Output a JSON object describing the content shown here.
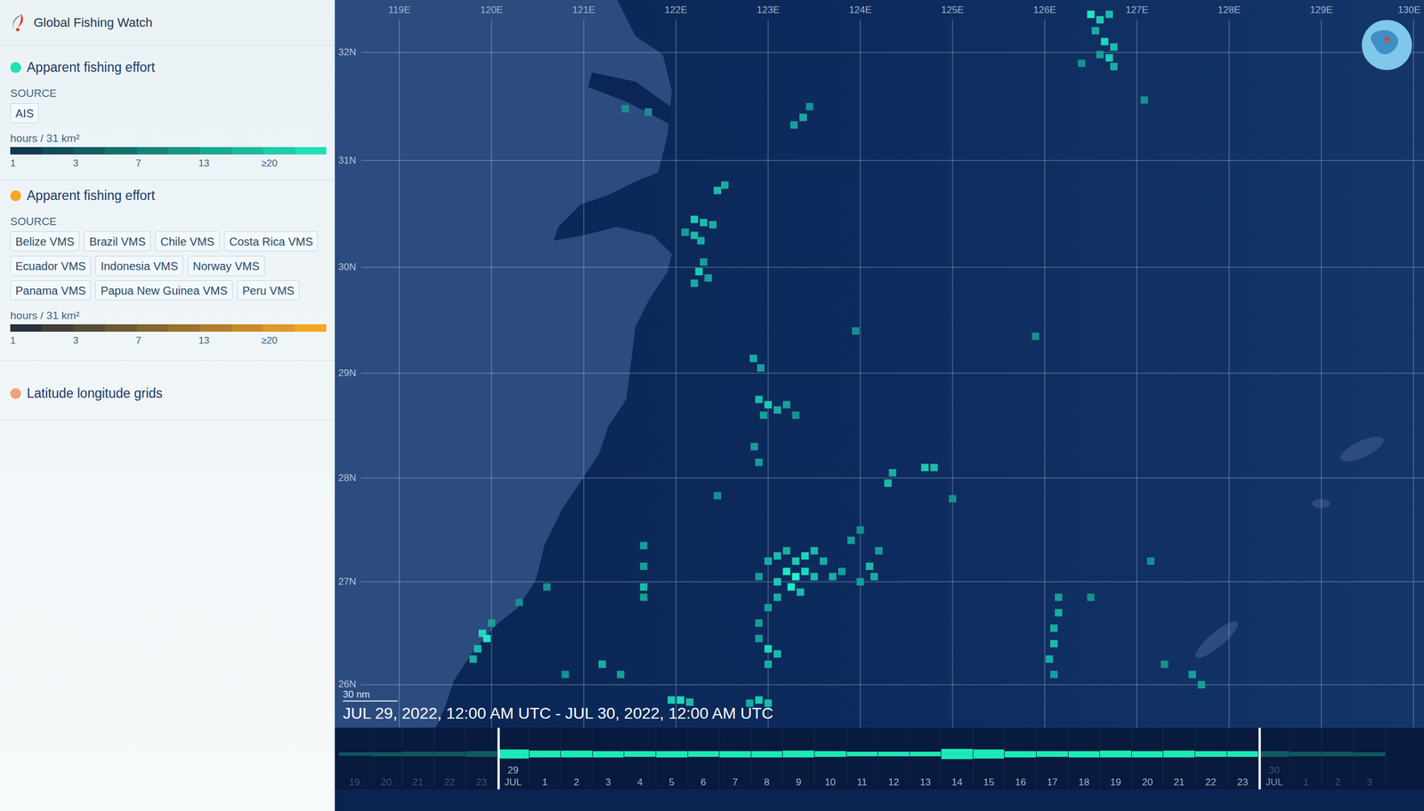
{
  "sidebar": {
    "app_title": "Global Fishing Watch",
    "layers": [
      {
        "title": "Apparent fishing effort",
        "color": "#1fe0b4",
        "source_label": "SOURCE",
        "sources": [
          "AIS"
        ],
        "unit": "hours / 31 km²",
        "ticks": [
          "1",
          "3",
          "7",
          "13",
          "≥20"
        ]
      },
      {
        "title": "Apparent fishing effort",
        "color": "#f6a623",
        "source_label": "SOURCE",
        "sources": [
          "Belize VMS",
          "Brazil VMS",
          "Chile VMS",
          "Costa Rica VMS",
          "Ecuador VMS",
          "Indonesia VMS",
          "Norway VMS",
          "Panama VMS",
          "Papua New Guinea VMS",
          "Peru VMS"
        ],
        "unit": "hours / 31 km²",
        "ticks": [
          "1",
          "3",
          "7",
          "13",
          "≥20"
        ]
      }
    ],
    "grid_layer": {
      "title": "Latitude longitude grids",
      "color": "#f0a07c"
    }
  },
  "map": {
    "longitudes": [
      {
        "value": 119,
        "label": "119E"
      },
      {
        "value": 120,
        "label": "120E"
      },
      {
        "value": 121,
        "label": "121E"
      },
      {
        "value": 122,
        "label": "122E"
      },
      {
        "value": 123,
        "label": "123E"
      },
      {
        "value": 124,
        "label": "124E"
      },
      {
        "value": 125,
        "label": "125E"
      },
      {
        "value": 126,
        "label": "126E"
      },
      {
        "value": 127,
        "label": "127E"
      },
      {
        "value": 128,
        "label": "128E"
      },
      {
        "value": 129,
        "label": "129E"
      },
      {
        "value": 130,
        "label": "130E"
      }
    ],
    "latitudes": [
      {
        "value": 32,
        "label": "32N"
      },
      {
        "value": 31,
        "label": "31N"
      },
      {
        "value": 30,
        "label": "30N"
      },
      {
        "value": 29,
        "label": "29N"
      },
      {
        "value": 28,
        "label": "28N"
      },
      {
        "value": 27,
        "label": "27N"
      },
      {
        "value": 26,
        "label": "26N"
      }
    ],
    "scale_label": "30 nm",
    "date_range": "JUL 29, 2022, 12:00 AM UTC - JUL 30, 2022, 12:00 AM UTC",
    "effort_cells": [
      [
        126.5,
        32.35,
        0.9
      ],
      [
        126.6,
        32.3,
        0.7
      ],
      [
        126.7,
        32.35,
        0.6
      ],
      [
        126.55,
        32.2,
        0.5
      ],
      [
        126.65,
        32.1,
        0.8
      ],
      [
        126.75,
        32.05,
        0.6
      ],
      [
        126.7,
        31.95,
        0.7
      ],
      [
        126.75,
        31.87,
        0.5
      ],
      [
        126.4,
        31.9,
        0.3
      ],
      [
        126.6,
        31.98,
        0.4
      ],
      [
        127.08,
        31.56,
        0.3
      ],
      [
        123.38,
        31.4,
        0.5
      ],
      [
        123.28,
        31.33,
        0.4
      ],
      [
        123.45,
        31.5,
        0.3
      ],
      [
        121.45,
        31.48,
        0.3
      ],
      [
        121.7,
        31.45,
        0.3
      ],
      [
        122.45,
        30.72,
        0.6
      ],
      [
        122.53,
        30.77,
        0.5
      ],
      [
        122.2,
        30.45,
        0.7
      ],
      [
        122.3,
        30.42,
        0.6
      ],
      [
        122.4,
        30.4,
        0.5
      ],
      [
        122.2,
        30.3,
        0.6
      ],
      [
        122.27,
        30.25,
        0.5
      ],
      [
        122.1,
        30.33,
        0.4
      ],
      [
        122.25,
        29.96,
        0.7
      ],
      [
        122.35,
        29.9,
        0.4
      ],
      [
        122.2,
        29.85,
        0.5
      ],
      [
        122.3,
        30.05,
        0.4
      ],
      [
        122.84,
        29.14,
        0.5
      ],
      [
        122.92,
        29.05,
        0.4
      ],
      [
        122.9,
        28.75,
        0.6
      ],
      [
        123.0,
        28.7,
        0.7
      ],
      [
        123.1,
        28.65,
        0.5
      ],
      [
        123.2,
        28.7,
        0.4
      ],
      [
        122.95,
        28.6,
        0.4
      ],
      [
        123.3,
        28.6,
        0.3
      ],
      [
        122.85,
        28.3,
        0.4
      ],
      [
        122.9,
        28.15,
        0.4
      ],
      [
        122.45,
        27.83,
        0.3
      ],
      [
        124.3,
        27.95,
        0.6
      ],
      [
        124.35,
        28.05,
        0.5
      ],
      [
        124.7,
        28.1,
        0.7
      ],
      [
        124.8,
        28.1,
        0.6
      ],
      [
        125.0,
        27.8,
        0.3
      ],
      [
        123.0,
        27.2,
        0.5
      ],
      [
        123.1,
        27.25,
        0.6
      ],
      [
        123.2,
        27.3,
        0.5
      ],
      [
        123.3,
        27.2,
        0.7
      ],
      [
        123.4,
        27.25,
        0.8
      ],
      [
        123.5,
        27.3,
        0.6
      ],
      [
        123.6,
        27.2,
        0.5
      ],
      [
        123.2,
        27.1,
        0.9
      ],
      [
        123.3,
        27.05,
        1
      ],
      [
        123.4,
        27.1,
        0.8
      ],
      [
        123.5,
        27.05,
        0.6
      ],
      [
        123.1,
        27.0,
        0.7
      ],
      [
        123.25,
        26.95,
        0.9
      ],
      [
        123.35,
        26.9,
        0.6
      ],
      [
        122.9,
        27.05,
        0.4
      ],
      [
        123.7,
        27.05,
        0.5
      ],
      [
        123.8,
        27.1,
        0.4
      ],
      [
        123.1,
        26.85,
        0.5
      ],
      [
        123.0,
        26.75,
        0.4
      ],
      [
        124.1,
        27.15,
        0.6
      ],
      [
        124.15,
        27.05,
        0.5
      ],
      [
        124.0,
        27.0,
        0.4
      ],
      [
        124.2,
        27.3,
        0.4
      ],
      [
        123.9,
        27.4,
        0.4
      ],
      [
        124.0,
        27.5,
        0.3
      ],
      [
        121.65,
        27.35,
        0.4
      ],
      [
        121.65,
        27.15,
        0.4
      ],
      [
        121.65,
        26.95,
        0.6
      ],
      [
        121.65,
        26.85,
        0.4
      ],
      [
        122.9,
        26.45,
        0.4
      ],
      [
        123.0,
        26.35,
        0.8
      ],
      [
        123.1,
        26.3,
        0.6
      ],
      [
        123.0,
        26.2,
        0.5
      ],
      [
        122.9,
        26.6,
        0.4
      ],
      [
        119.9,
        26.5,
        0.8
      ],
      [
        119.95,
        26.45,
        0.9
      ],
      [
        119.85,
        26.35,
        0.6
      ],
      [
        119.8,
        26.25,
        0.5
      ],
      [
        120.0,
        26.6,
        0.4
      ],
      [
        120.3,
        26.8,
        0.3
      ],
      [
        120.6,
        26.95,
        0.3
      ],
      [
        121.95,
        25.85,
        0.7
      ],
      [
        122.05,
        25.85,
        0.8
      ],
      [
        122.15,
        25.83,
        0.6
      ],
      [
        122.9,
        25.85,
        0.7
      ],
      [
        123.0,
        25.82,
        0.6
      ],
      [
        122.8,
        25.82,
        0.5
      ],
      [
        121.2,
        26.2,
        0.5
      ],
      [
        121.4,
        26.1,
        0.4
      ],
      [
        120.8,
        26.1,
        0.3
      ],
      [
        126.15,
        26.85,
        0.4
      ],
      [
        126.15,
        26.7,
        0.5
      ],
      [
        126.1,
        26.55,
        0.5
      ],
      [
        126.1,
        26.4,
        0.6
      ],
      [
        126.05,
        26.25,
        0.5
      ],
      [
        126.1,
        26.1,
        0.4
      ],
      [
        126.5,
        26.85,
        0.3
      ],
      [
        127.3,
        26.2,
        0.3
      ],
      [
        127.6,
        26.1,
        0.4
      ],
      [
        127.7,
        26.0,
        0.4
      ],
      [
        127.15,
        27.2,
        0.3
      ],
      [
        125.9,
        29.35,
        0.3
      ],
      [
        123.95,
        29.4,
        0.3
      ]
    ]
  },
  "timeline": {
    "ticks": [
      {
        "label": "19",
        "in_range": false,
        "handle": false,
        "activity": 0.2
      },
      {
        "label": "20",
        "in_range": false,
        "handle": false,
        "activity": 0.25
      },
      {
        "label": "21",
        "in_range": false,
        "handle": false,
        "activity": 0.3
      },
      {
        "label": "22",
        "in_range": false,
        "handle": false,
        "activity": 0.35
      },
      {
        "label": "23",
        "in_range": false,
        "handle": false,
        "activity": 0.4
      },
      {
        "label": "29",
        "sublabel": "JUL",
        "in_range": true,
        "handle": true,
        "activity": 0.8
      },
      {
        "label": "1",
        "in_range": true,
        "handle": false,
        "activity": 0.6
      },
      {
        "label": "2",
        "in_range": true,
        "handle": false,
        "activity": 0.6
      },
      {
        "label": "3",
        "in_range": true,
        "handle": false,
        "activity": 0.5
      },
      {
        "label": "4",
        "in_range": true,
        "handle": false,
        "activity": 0.45
      },
      {
        "label": "5",
        "in_range": true,
        "handle": false,
        "activity": 0.5
      },
      {
        "label": "6",
        "in_range": true,
        "handle": false,
        "activity": 0.45
      },
      {
        "label": "7",
        "in_range": true,
        "handle": false,
        "activity": 0.5
      },
      {
        "label": "8",
        "in_range": true,
        "handle": false,
        "activity": 0.5
      },
      {
        "label": "9",
        "in_range": true,
        "handle": false,
        "activity": 0.55
      },
      {
        "label": "10",
        "in_range": true,
        "handle": false,
        "activity": 0.4
      },
      {
        "label": "11",
        "in_range": true,
        "handle": false,
        "activity": 0.35
      },
      {
        "label": "12",
        "in_range": true,
        "handle": false,
        "activity": 0.3
      },
      {
        "label": "13",
        "in_range": true,
        "handle": false,
        "activity": 0.35
      },
      {
        "label": "14",
        "in_range": true,
        "handle": false,
        "activity": 0.9
      },
      {
        "label": "15",
        "in_range": true,
        "handle": false,
        "activity": 0.8
      },
      {
        "label": "16",
        "in_range": true,
        "handle": false,
        "activity": 0.5
      },
      {
        "label": "17",
        "in_range": true,
        "handle": false,
        "activity": 0.45
      },
      {
        "label": "18",
        "in_range": true,
        "handle": false,
        "activity": 0.5
      },
      {
        "label": "19",
        "in_range": true,
        "handle": false,
        "activity": 0.55
      },
      {
        "label": "20",
        "in_range": true,
        "handle": false,
        "activity": 0.5
      },
      {
        "label": "21",
        "in_range": true,
        "handle": false,
        "activity": 0.55
      },
      {
        "label": "22",
        "in_range": true,
        "handle": false,
        "activity": 0.45
      },
      {
        "label": "23",
        "in_range": true,
        "handle": false,
        "activity": 0.45
      },
      {
        "label": "30",
        "sublabel": "JUL",
        "in_range": false,
        "handle": true,
        "activity": 0.4
      },
      {
        "label": "1",
        "in_range": false,
        "handle": false,
        "activity": 0.35
      },
      {
        "label": "2",
        "in_range": false,
        "handle": false,
        "activity": 0.3
      },
      {
        "label": "3",
        "in_range": false,
        "handle": false,
        "activity": 0.25
      }
    ]
  }
}
